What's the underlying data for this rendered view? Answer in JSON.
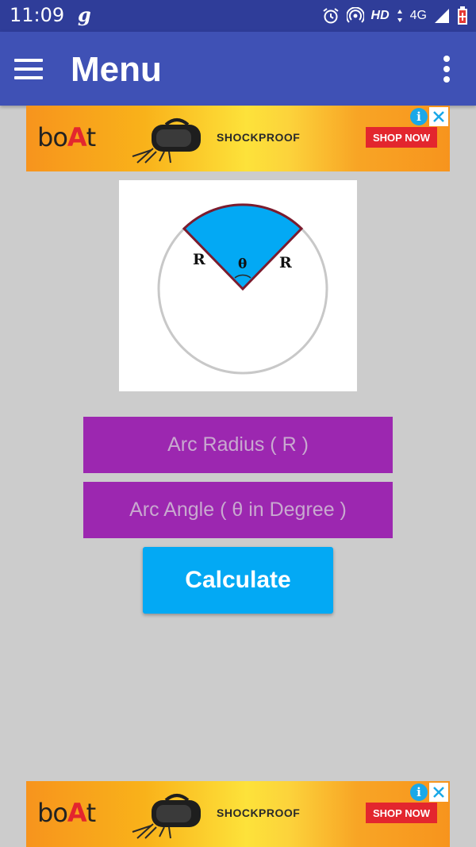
{
  "status_bar": {
    "time": "11:09",
    "app_indicator": "g",
    "network": "HD",
    "network_type": "4G"
  },
  "app_bar": {
    "title": "Menu"
  },
  "ads": {
    "top": {
      "brand": "boAt",
      "headline": "SHOCKPROOF",
      "cta": "SHOP NOW"
    },
    "bottom": {
      "brand": "boAt",
      "headline": "SHOCKPROOF",
      "cta": "SHOP NOW"
    }
  },
  "diagram": {
    "label_left": "R",
    "label_right": "R",
    "label_angle": "θ",
    "colors": {
      "sector": "#03a9f4",
      "outline": "#7b1c2e",
      "circle": "#c8c8c8"
    }
  },
  "form": {
    "radius_placeholder": "Arc Radius ( R )",
    "angle_placeholder": "Arc Angle ( θ in Degree )",
    "calculate_label": "Calculate"
  },
  "colors": {
    "status_bar": "#2f3d99",
    "app_bar": "#3f51b5",
    "field": "#9c27b0",
    "button": "#03a9f4",
    "background": "#cccccc"
  }
}
